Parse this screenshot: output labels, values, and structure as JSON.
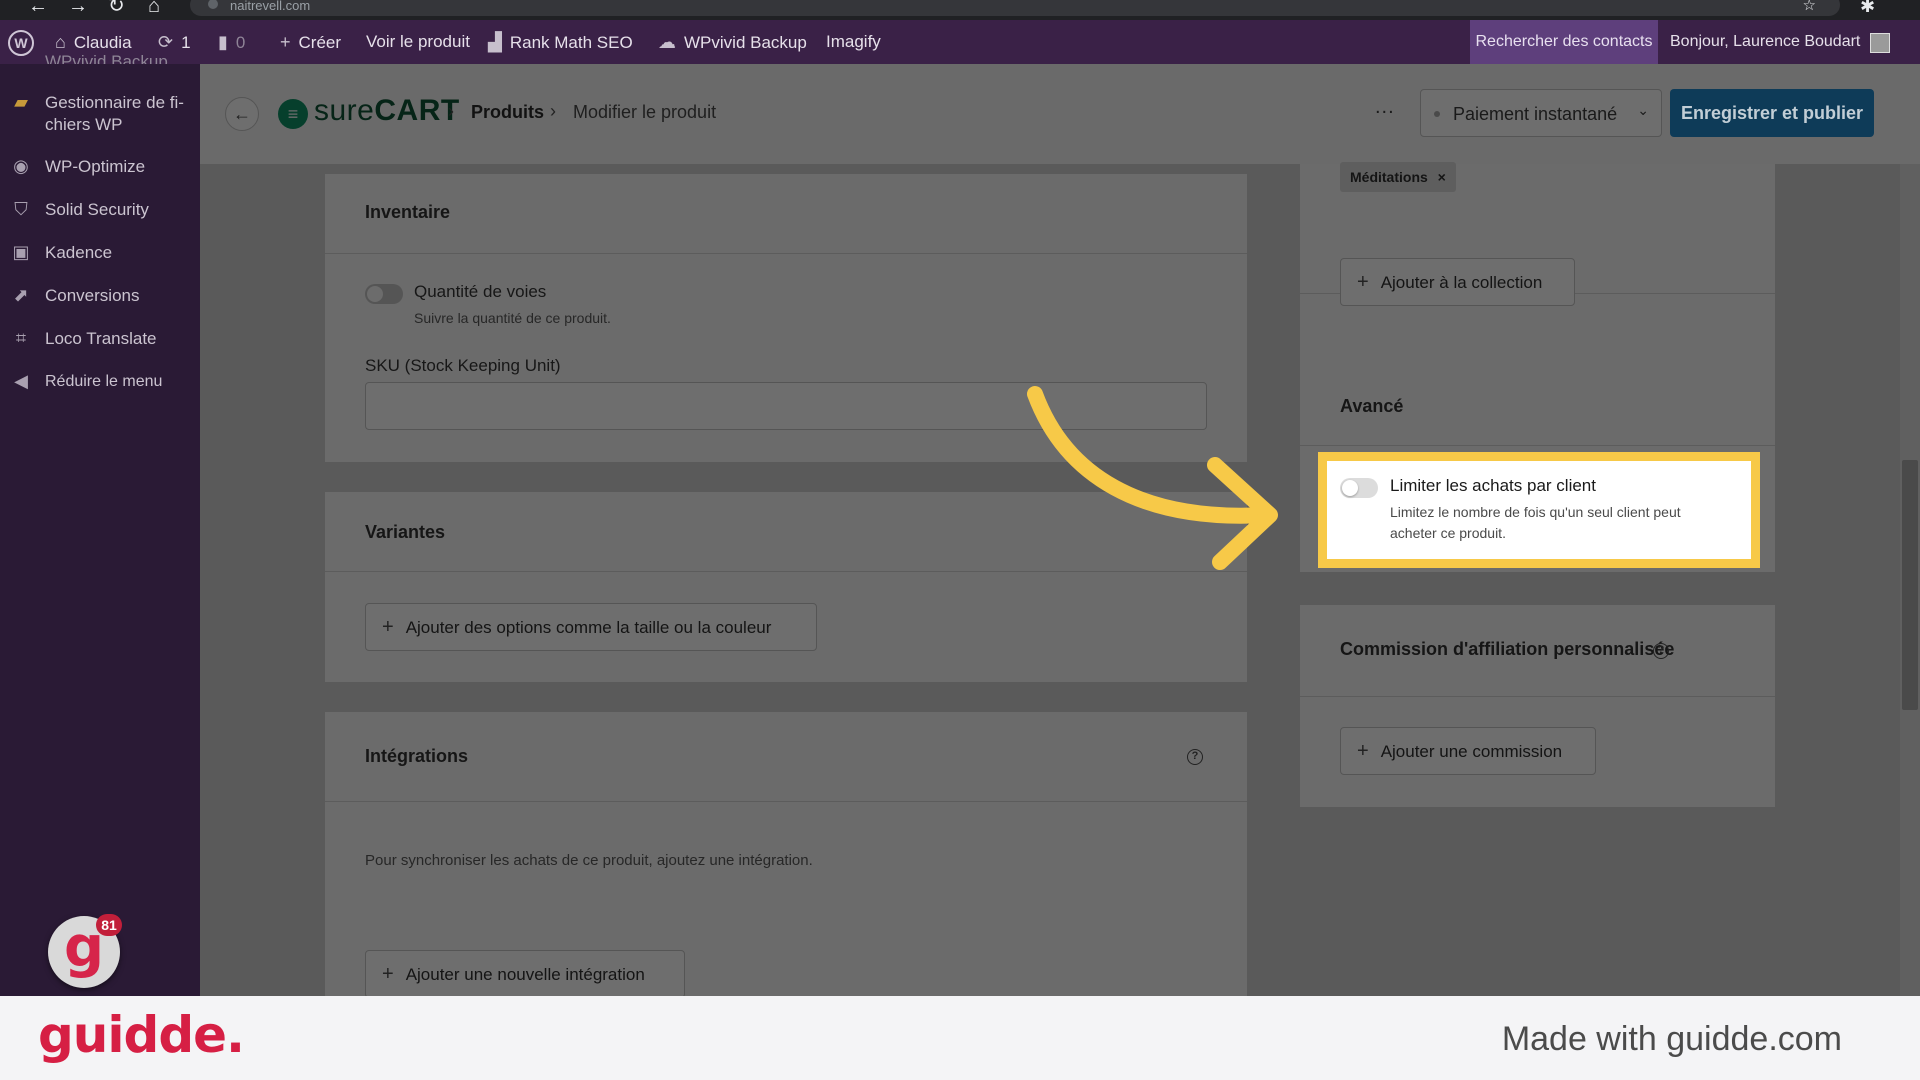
{
  "browser": {
    "url": "naitrevell.com"
  },
  "adminbar": {
    "site_name": "Claudia",
    "updates_count": "1",
    "comments_count": "0",
    "create_label": "Créer",
    "view_product_label": "Voir le produit",
    "rank_math_label": "Rank Math SEO",
    "wpvivid_label": "WPvivid Backup",
    "imagify_label": "Imagify",
    "search_contacts_label": "Rechercher des contacts",
    "greeting": "Bonjour, Laurence Boudart"
  },
  "sidebar": {
    "cut_item": "WPvivid Backup",
    "items": [
      {
        "label_line1": "Gestionnaire de fi-",
        "label_line2": "chiers WP"
      },
      {
        "label": "WP-Optimize"
      },
      {
        "label": "Solid Security"
      },
      {
        "label": "Kadence"
      },
      {
        "label": "Conversions"
      },
      {
        "label": "Loco Translate"
      },
      {
        "label": "Réduire le menu"
      }
    ],
    "guidde_count": "81"
  },
  "header": {
    "logo_text_light": "sure",
    "logo_text_bold": "CART",
    "breadcrumb_products": "Produits",
    "breadcrumb_edit": "Modifier le produit",
    "more_label": "...",
    "payment_select_value": "Paiement instantané",
    "save_button": "Enregistrer et publier"
  },
  "inventory": {
    "title": "Inventaire",
    "track_label": "Quantité de voies",
    "track_desc": "Suivre la quantité de ce produit.",
    "sku_label": "SKU (Stock Keeping Unit)",
    "sku_value": ""
  },
  "variants": {
    "title": "Variantes",
    "add_button": "Ajouter des options comme la taille ou la couleur"
  },
  "integrations": {
    "title": "Intégrations",
    "help": "?",
    "empty_text": "Pour synchroniser les achats de ce produit, ajoutez une intégration.",
    "add_button": "Ajouter une nouvelle intégration"
  },
  "collections": {
    "tag": "Méditations",
    "tag_remove": "×",
    "add_button": "Ajouter à la collection"
  },
  "advanced": {
    "title": "Avancé",
    "limit_label": "Limiter les achats par client",
    "limit_desc": "Limitez le nombre de fois qu'un seul client peut acheter ce produit."
  },
  "affiliation": {
    "title": "Commission d'affiliation personnalisée",
    "help": "?",
    "add_button": "Ajouter une commission"
  },
  "footer": {
    "logo": "guidde.",
    "made_with": "Made with guidde.com"
  },
  "colors": {
    "highlight": "#f7c948",
    "admin_bar": "#3a2147",
    "sidebar": "#2a1a35",
    "save_button": "#0e3b58",
    "guidde_red": "#d61f44"
  }
}
